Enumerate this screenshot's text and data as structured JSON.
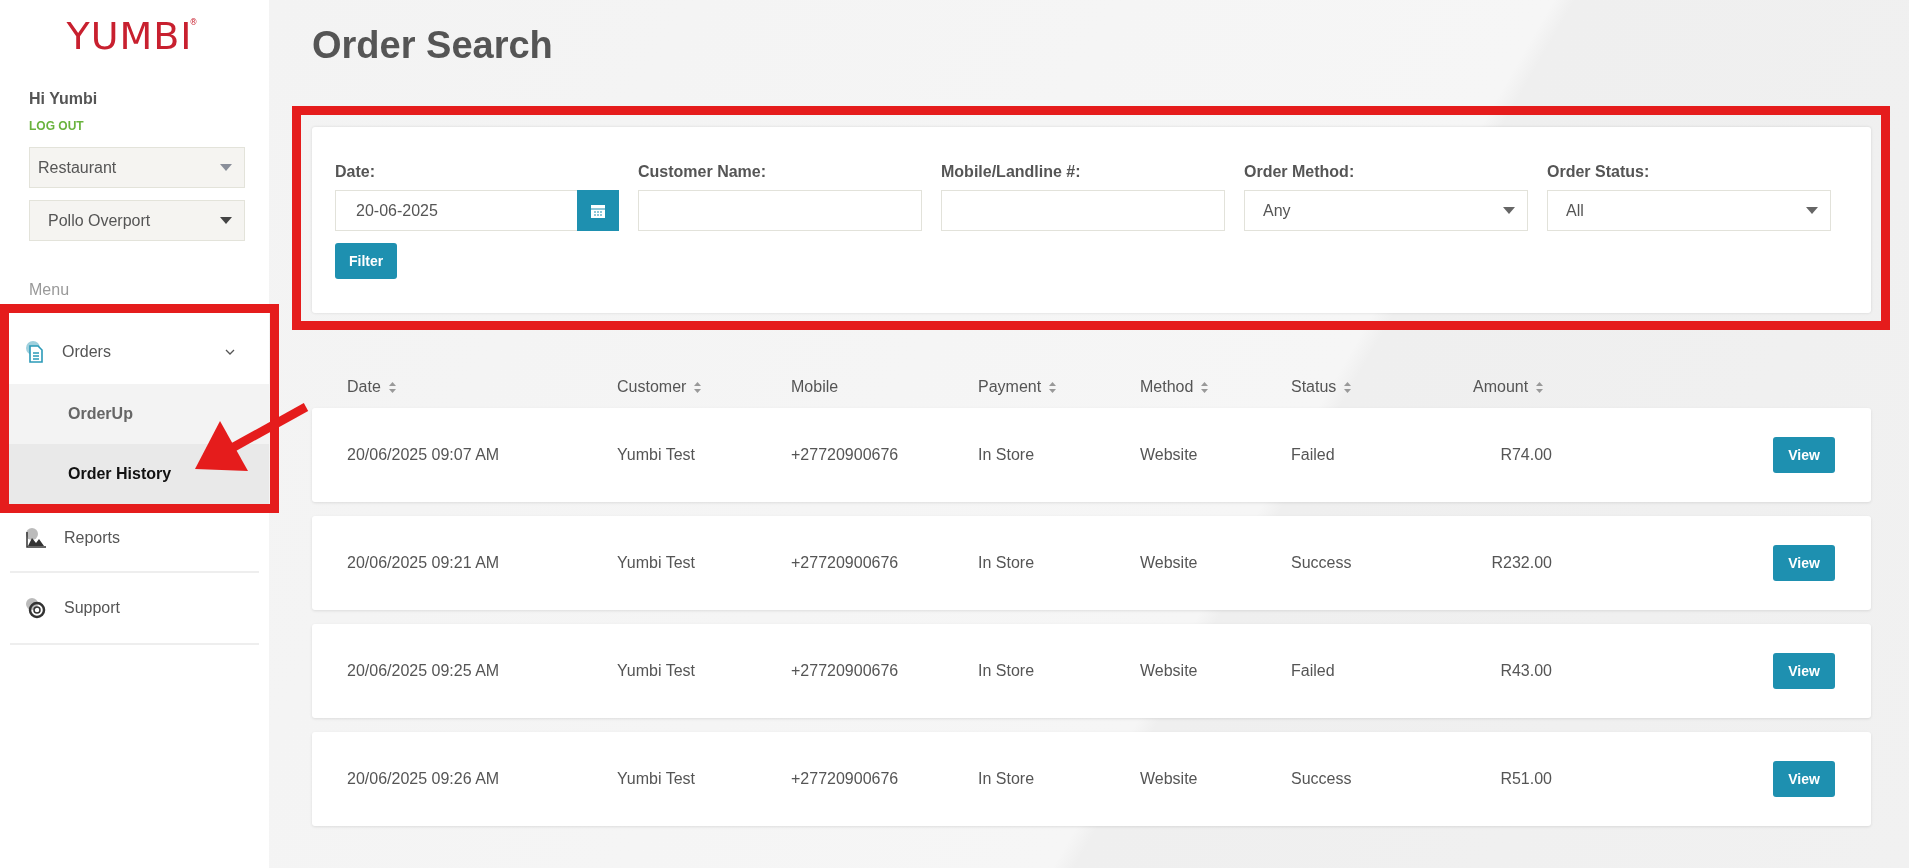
{
  "sidebar": {
    "logo": "YUMBI",
    "logo_mark": "®",
    "greeting": "Hi Yumbi",
    "logout": "LOG OUT",
    "selects": [
      {
        "value": "Restaurant"
      },
      {
        "value": "Pollo Overport"
      }
    ],
    "menu_heading": "Menu",
    "items": [
      {
        "label": "Orders",
        "kind": "group",
        "expanded": true,
        "children": [
          {
            "label": "OrderUp",
            "selected": false
          },
          {
            "label": "Order History",
            "selected": true
          }
        ]
      },
      {
        "label": "Reports",
        "kind": "link"
      },
      {
        "label": "Support",
        "kind": "link"
      }
    ]
  },
  "page_title": "Order Search",
  "filters": {
    "fields": [
      {
        "label": "Date:",
        "kind": "date",
        "value": "20-06-2025"
      },
      {
        "label": "Customer Name:",
        "kind": "text"
      },
      {
        "label": "Mobile/Landline #:",
        "kind": "text"
      },
      {
        "label": "Order Method:",
        "kind": "select",
        "value": "Any"
      },
      {
        "label": "Order Status:",
        "kind": "select",
        "value": "All"
      }
    ],
    "button": "Filter"
  },
  "table": {
    "columns": [
      {
        "label": "Date",
        "sortable": true
      },
      {
        "label": "Customer",
        "sortable": true
      },
      {
        "label": "Mobile",
        "sortable": false
      },
      {
        "label": "Payment",
        "sortable": true
      },
      {
        "label": "Method",
        "sortable": true
      },
      {
        "label": "Status",
        "sortable": true
      },
      {
        "label": "Amount",
        "sortable": true
      }
    ],
    "rows": [
      {
        "cells": [
          "20/06/2025 09:07 AM",
          "Yumbi Test",
          "+27720900676",
          "In Store",
          "Website",
          "Failed",
          "R74.00"
        ],
        "action": "View"
      },
      {
        "cells": [
          "20/06/2025 09:21 AM",
          "Yumbi Test",
          "+27720900676",
          "In Store",
          "Website",
          "Success",
          "R232.00"
        ],
        "action": "View"
      },
      {
        "cells": [
          "20/06/2025 09:25 AM",
          "Yumbi Test",
          "+27720900676",
          "In Store",
          "Website",
          "Failed",
          "R43.00"
        ],
        "action": "View"
      },
      {
        "cells": [
          "20/06/2025 09:26 AM",
          "Yumbi Test",
          "+27720900676",
          "In Store",
          "Website",
          "Success",
          "R51.00"
        ],
        "action": "View"
      }
    ]
  }
}
